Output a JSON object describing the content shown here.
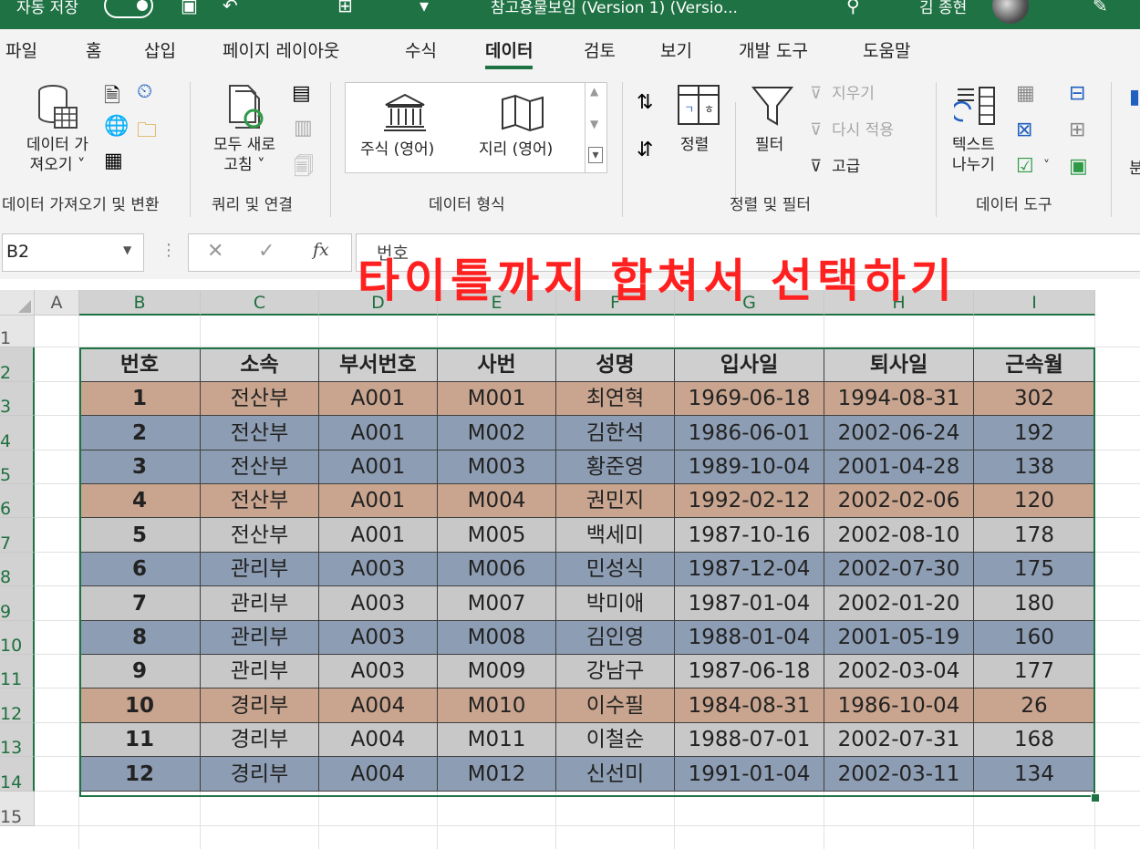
{
  "titlebar": {
    "autosave": "자동 저장",
    "filename": "참고용물보임 (Version 1) (Versio...",
    "user": "김 종현"
  },
  "ribbon": {
    "tabs": [
      "파일",
      "홈",
      "삽입",
      "페이지 레이아웃",
      "수식",
      "데이터",
      "검토",
      "보기",
      "개발 도구",
      "도움말"
    ],
    "active_tab": "데이터",
    "get_data": {
      "line1": "데이터 가",
      "line2": "져오기 ˅",
      "group": "데이터 가져오기 및 변환"
    },
    "refresh": {
      "line1": "모두 새로",
      "line2": "고침 ˅",
      "group": "쿼리 및 연결"
    },
    "data_types": {
      "stocks": "주식 (영어)",
      "geography": "지리 (영어)",
      "group": "데이터 형식"
    },
    "sort_filter": {
      "sort": "정렬",
      "filter": "필터",
      "clear": "지우기",
      "reapply": "다시 적용",
      "advanced": "고급",
      "group": "정렬 및 필터"
    },
    "data_tools": {
      "text_to_columns_1": "텍스트",
      "text_to_columns_2": "나누기",
      "group": "데이터 도구"
    },
    "cut_off": "분"
  },
  "formula_bar": {
    "name_box": "B2",
    "formula": "번호"
  },
  "overlay_text": "타이틀까지 합쳐서 선택하기",
  "columns": [
    "A",
    "B",
    "C",
    "D",
    "E",
    "F",
    "G",
    "H",
    "I"
  ],
  "rows": [
    "1",
    "2",
    "3",
    "4",
    "5",
    "6",
    "7",
    "8",
    "9",
    "10",
    "11",
    "12",
    "13",
    "14",
    "15"
  ],
  "table": {
    "headers": [
      "번호",
      "소속",
      "부서번호",
      "사번",
      "성명",
      "입사일",
      "퇴사일",
      "근속월"
    ],
    "rows": [
      [
        "1",
        "전산부",
        "A001",
        "M001",
        "최연혁",
        "1969-06-18",
        "1994-08-31",
        "302"
      ],
      [
        "2",
        "전산부",
        "A001",
        "M002",
        "김한석",
        "1986-06-01",
        "2002-06-24",
        "192"
      ],
      [
        "3",
        "전산부",
        "A001",
        "M003",
        "황준영",
        "1989-10-04",
        "2001-04-28",
        "138"
      ],
      [
        "4",
        "전산부",
        "A001",
        "M004",
        "권민지",
        "1992-02-12",
        "2002-02-06",
        "120"
      ],
      [
        "5",
        "전산부",
        "A001",
        "M005",
        "백세미",
        "1987-10-16",
        "2002-08-10",
        "178"
      ],
      [
        "6",
        "관리부",
        "A003",
        "M006",
        "민성식",
        "1987-12-04",
        "2002-07-30",
        "175"
      ],
      [
        "7",
        "관리부",
        "A003",
        "M007",
        "박미애",
        "1987-01-04",
        "2002-01-20",
        "180"
      ],
      [
        "8",
        "관리부",
        "A003",
        "M008",
        "김인영",
        "1988-01-04",
        "2001-05-19",
        "160"
      ],
      [
        "9",
        "관리부",
        "A003",
        "M009",
        "강남구",
        "1987-06-18",
        "2002-03-04",
        "177"
      ],
      [
        "10",
        "경리부",
        "A004",
        "M010",
        "이수필",
        "1984-08-31",
        "1986-10-04",
        "26"
      ],
      [
        "11",
        "경리부",
        "A004",
        "M011",
        "이철순",
        "1988-07-01",
        "2002-07-31",
        "168"
      ],
      [
        "12",
        "경리부",
        "A004",
        "M012",
        "신선미",
        "1991-01-04",
        "2002-03-11",
        "134"
      ]
    ],
    "row_colors": [
      "tan",
      "blue",
      "blue",
      "tan",
      "gray",
      "blue",
      "gray",
      "blue",
      "gray",
      "tan",
      "gray",
      "blue"
    ]
  },
  "colors": {
    "tan": "#c9a58f",
    "blue": "#8d9db3",
    "gray": "#c8c8c8",
    "accent": "#1f7244",
    "overlay": "#ff2020"
  }
}
